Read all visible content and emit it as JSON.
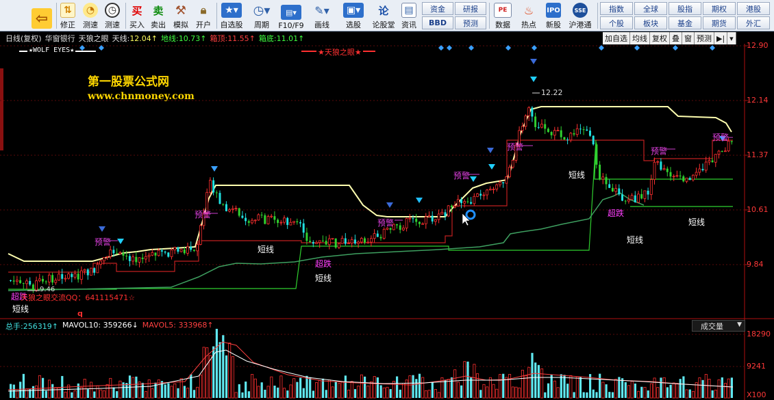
{
  "toolbar": {
    "buttons": [
      {
        "label": "",
        "icon": "back-arrow-icon"
      },
      {
        "label": "修正",
        "icon": "fix-icon"
      },
      {
        "label": "测速",
        "icon": "speed-icon"
      },
      {
        "label": "买入",
        "icon": "buy-icon",
        "glyph": "买"
      },
      {
        "label": "卖出",
        "icon": "sell-icon",
        "glyph": "卖"
      },
      {
        "label": "模拟",
        "icon": "hammer-icon"
      },
      {
        "label": "开户",
        "icon": "lock-icon"
      },
      {
        "label": "自选股",
        "icon": "star-icon"
      },
      {
        "label": "周期",
        "icon": "clock-icon"
      },
      {
        "label": "F10/F9",
        "icon": "f10-icon"
      },
      {
        "label": "画线",
        "icon": "pencil-icon"
      },
      {
        "label": "选股",
        "icon": "monitor-icon"
      },
      {
        "label": "论股堂",
        "icon": "forum-icon",
        "glyph": "论"
      },
      {
        "label": "资讯",
        "icon": "doc-icon"
      },
      {
        "label": "数据",
        "icon": "pe-icon",
        "glyph": "PE"
      },
      {
        "label": "热点",
        "icon": "hot-icon"
      },
      {
        "label": "新股",
        "icon": "ipo-icon"
      },
      {
        "label": "沪港通",
        "icon": "sse-hkex-icon"
      }
    ],
    "grid_left": [
      "资金",
      "研报",
      "BBD",
      "预测"
    ],
    "grid_right": [
      "指数",
      "全球",
      "股指",
      "期权",
      "港股",
      "个股",
      "板块",
      "基金",
      "期货",
      "外汇"
    ]
  },
  "info_bar": {
    "period": "日线(复权)",
    "stock": "华窗银行",
    "indicator": "天狼之眼",
    "tianxian_label": "天线:",
    "tianxian_value": "12.04↑",
    "dixian_label": "地线:",
    "dixian_value": "10.73↑",
    "xiangding_label": "箱顶:",
    "xiangding_value": "11.55↑",
    "xiangdi_label": "箱底:",
    "xiangdi_value": "11.01↑"
  },
  "right_buttons": [
    "加自选",
    "均线",
    "复权",
    "叠",
    "窗",
    "预测",
    "▶|",
    "▾"
  ],
  "price_axis": [
    "12.90",
    "12.14",
    "11.37",
    "10.61",
    "9.84"
  ],
  "volume_axis": [
    "18290",
    "9241",
    "X100"
  ],
  "chart_texts": {
    "wolf_eyes": "★WOLF EYES★",
    "tianlang_legend": "★天狼之眼★",
    "watermark_cn": "第一股票公式网",
    "watermark_url": "www.chnmoney.com",
    "high_marker": "12.22",
    "low_marker": "9.46",
    "duanxian": "短线",
    "yujing": "预警",
    "chaodie": "超跌",
    "qq_line": "天狼之眼交流QQ：641115471☆",
    "q_marker": "q"
  },
  "volume_bar": {
    "total_label": "总手:",
    "total_value": "256319↑",
    "ma10_label": "MAVOL10:",
    "ma10_value": "359266↓",
    "ma5_label": "MAVOL5:",
    "ma5_value": "333968↑",
    "selector": "成交量"
  },
  "colors": {
    "up": "#ff3030",
    "down": "#20e0e0",
    "tianxian": "#ffffb0",
    "box_red": "#c02020",
    "box_green": "#2fd02f",
    "dixian": "#40b060",
    "info_white": "#e0e0e0",
    "info_green": "#40ff40",
    "info_red": "#ff4040"
  }
}
